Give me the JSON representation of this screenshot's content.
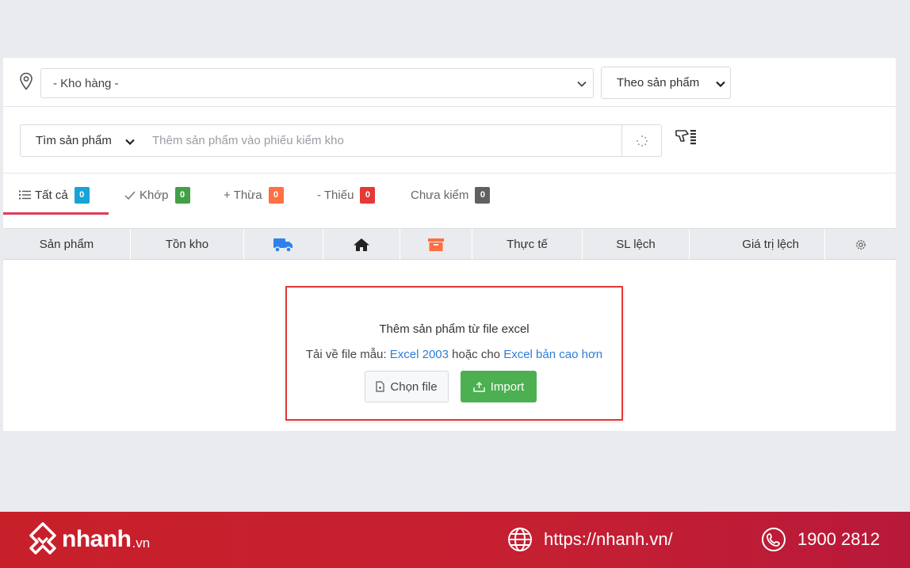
{
  "toolbar": {
    "warehouse_select": "- Kho hàng -",
    "group_select": "Theo sản phẩm"
  },
  "search": {
    "mode": "Tìm sản phẩm",
    "placeholder": "Thêm sản phẩm vào phiếu kiểm kho"
  },
  "tabs": [
    {
      "label": "Tất cả",
      "count": "0",
      "color": "#17a2d8",
      "icon": "list-icon"
    },
    {
      "label": "Khớp",
      "count": "0",
      "color": "#43a047",
      "icon": "check-icon"
    },
    {
      "label": "+ Thừa",
      "count": "0",
      "color": "#ff7043",
      "icon": ""
    },
    {
      "label": "- Thiếu",
      "count": "0",
      "color": "#e53935",
      "icon": ""
    },
    {
      "label": "Chưa kiểm",
      "count": "0",
      "color": "#616161",
      "icon": ""
    }
  ],
  "table": {
    "columns": [
      "Sản phẩm",
      "Tồn kho",
      "truck-icon",
      "home-icon",
      "archive-icon",
      "Thực tế",
      "SL lệch",
      "Giá trị lệch",
      "gear-icon"
    ],
    "icon_colors": {
      "truck": "#2f80ed",
      "home": "#222222",
      "archive": "#ff6e40"
    }
  },
  "import": {
    "title": "Thêm sản phẩm từ file excel",
    "sub_prefix": "Tải về file mẫu:",
    "link1": "Excel 2003",
    "sub_middle": "hoặc cho",
    "link2": "Excel bản cao hơn",
    "choose_file": "Chọn file",
    "import_button": "Import",
    "highlight_color": "#e53935"
  },
  "footer": {
    "brand": "nhanh",
    "tld": ".vn",
    "website": "https://nhanh.vn/",
    "phone": "1900 2812"
  }
}
